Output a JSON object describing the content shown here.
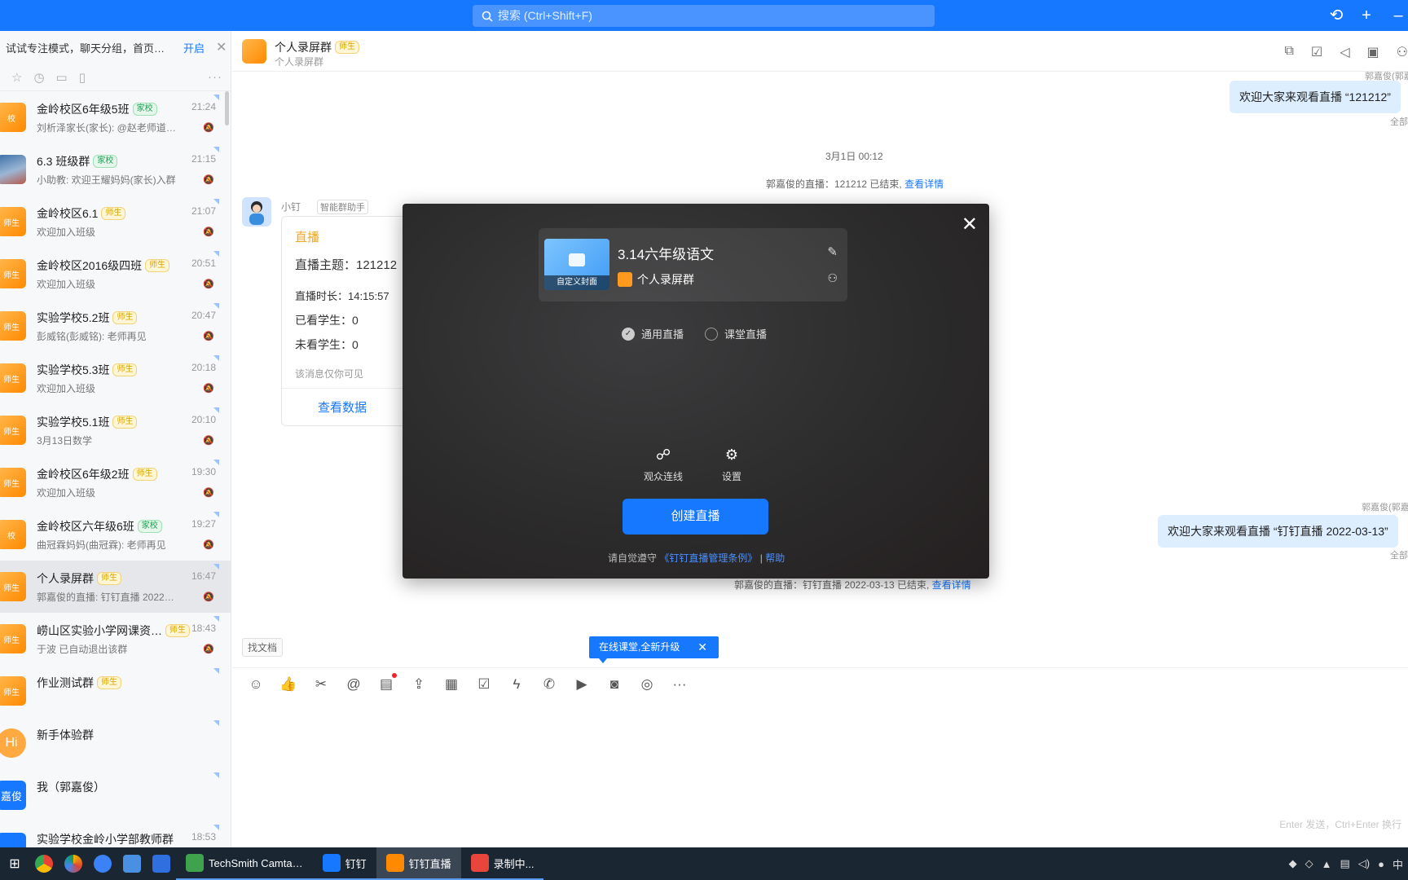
{
  "search": {
    "placeholder": "搜索 (Ctrl+Shift+F)"
  },
  "sidebar": {
    "focus_tip": "试试专注模式，聊天分组，首页…",
    "focus_open": "开启",
    "conversations": [
      {
        "name": "金岭校区6年级5班",
        "tag": "家校",
        "tagtype": "home",
        "msg": "刘析泽家长(家长): @赵老师道…",
        "time": "21:24",
        "avatar": "校"
      },
      {
        "name": "6.3 班级群",
        "tag": "家校",
        "tagtype": "home",
        "msg": "小助教: 欢迎王耀妈妈(家长)入群",
        "time": "21:15",
        "avatar": "",
        "photo": true
      },
      {
        "name": "金岭校区6.1",
        "tag": "师生",
        "tagtype": "teacher",
        "msg": "欢迎加入班级",
        "time": "21:07",
        "avatar": "师生"
      },
      {
        "name": "金岭校区2016级四班",
        "tag": "师生",
        "tagtype": "teacher",
        "msg": "欢迎加入班级",
        "time": "20:51",
        "avatar": "师生"
      },
      {
        "name": "实验学校5.2班",
        "tag": "师生",
        "tagtype": "teacher",
        "msg": "彭威铭(彭威铭): 老师再见",
        "time": "20:47",
        "avatar": "师生"
      },
      {
        "name": "实验学校5.3班",
        "tag": "师生",
        "tagtype": "teacher",
        "msg": "欢迎加入班级",
        "time": "20:18",
        "avatar": "师生"
      },
      {
        "name": "实验学校5.1班",
        "tag": "师生",
        "tagtype": "teacher",
        "msg": "3月13日数学",
        "time": "20:10",
        "avatar": "师生"
      },
      {
        "name": "金岭校区6年级2班",
        "tag": "师生",
        "tagtype": "teacher",
        "msg": "欢迎加入班级",
        "time": "19:30",
        "avatar": "师生"
      },
      {
        "name": "金岭校区六年级6班",
        "tag": "家校",
        "tagtype": "home",
        "msg": "曲冠霖妈妈(曲冠霖): 老师再见",
        "time": "19:27",
        "avatar": "校"
      },
      {
        "name": "个人录屏群",
        "tag": "师生",
        "tagtype": "teacher",
        "msg": "郭嘉俊的直播: 钉钉直播 2022…",
        "time": "16:47",
        "avatar": "师生",
        "active": true
      },
      {
        "name": "崂山区实验小学网课资…",
        "tag": "师生",
        "tagtype": "teacher",
        "msg": "于波 已自动退出该群",
        "time": "18:43",
        "avatar": "师生"
      },
      {
        "name": "作业测试群",
        "tag": "师生",
        "tagtype": "teacher",
        "msg": "",
        "time": "",
        "avatar": "师生"
      },
      {
        "name": "新手体验群",
        "tag": "",
        "tagtype": "",
        "msg": "",
        "time": "",
        "avatar": "Hi",
        "face": true
      },
      {
        "name": "我（郭嘉俊）",
        "tag": "",
        "tagtype": "",
        "msg": "",
        "time": "",
        "avatar": "嘉俊",
        "blue": true
      },
      {
        "name": "实验学校金岭小学部教师群",
        "tag": "",
        "tagtype": "",
        "msg": "",
        "time": "18:53",
        "avatar": "",
        "blue": true
      }
    ]
  },
  "header": {
    "title": "个人录屏群",
    "tag": "师生",
    "subtitle": "个人录屏群"
  },
  "chat": {
    "bubble1": "欢迎大家来观看直播 “121212”",
    "sender_top": "郭嘉俊(郭嘉",
    "read1": "全部",
    "date": "3月1日 00:12",
    "sys1_text": "郭嘉俊的直播：121212 已结束,",
    "sys1_link": "查看详情",
    "bot_name": "小钉",
    "bot_tag": "智能群助手",
    "card": {
      "title": "直播",
      "topic": "直播主题：121212",
      "duration": "直播时长：14:15:57",
      "watched": "已看学生：0",
      "unwatched": "未看学生：0",
      "note": "该消息仅你可见",
      "button": "查看数据"
    },
    "sender2": "郭嘉俊(郭嘉",
    "bubble2": "欢迎大家来观看直播 “钉钉直播 2022-03-13”",
    "read2": "全部",
    "sys2_text": "郭嘉俊的直播：钉钉直播 2022-03-13 已结束,",
    "sys2_link": "查看详情",
    "find_doc": "找文档",
    "upgrade": "在线课堂,全新升级",
    "enter_hint": "Enter 发送，Ctrl+Enter 换行"
  },
  "modal": {
    "cover_label": "自定义封面",
    "title": "3.14六年级语文",
    "group": "个人录屏群",
    "radio_general": "通用直播",
    "radio_class": "课堂直播",
    "tool_audience": "观众连线",
    "tool_settings": "设置",
    "create_button": "创建直播",
    "terms_prefix": "请自觉遵守",
    "terms_link": "《钉钉直播管理条例》",
    "terms_sep": "|",
    "help": "帮助"
  },
  "taskbar": {
    "apps": [
      {
        "label": "TechSmith Camta…",
        "color": "#3fa34d"
      },
      {
        "label": "钉钉",
        "color": "#1677ff"
      },
      {
        "label": "钉钉直播",
        "color": "#ff8a00",
        "active": true
      },
      {
        "label": "录制中...",
        "color": "#e8453c"
      }
    ],
    "ime": "中"
  }
}
